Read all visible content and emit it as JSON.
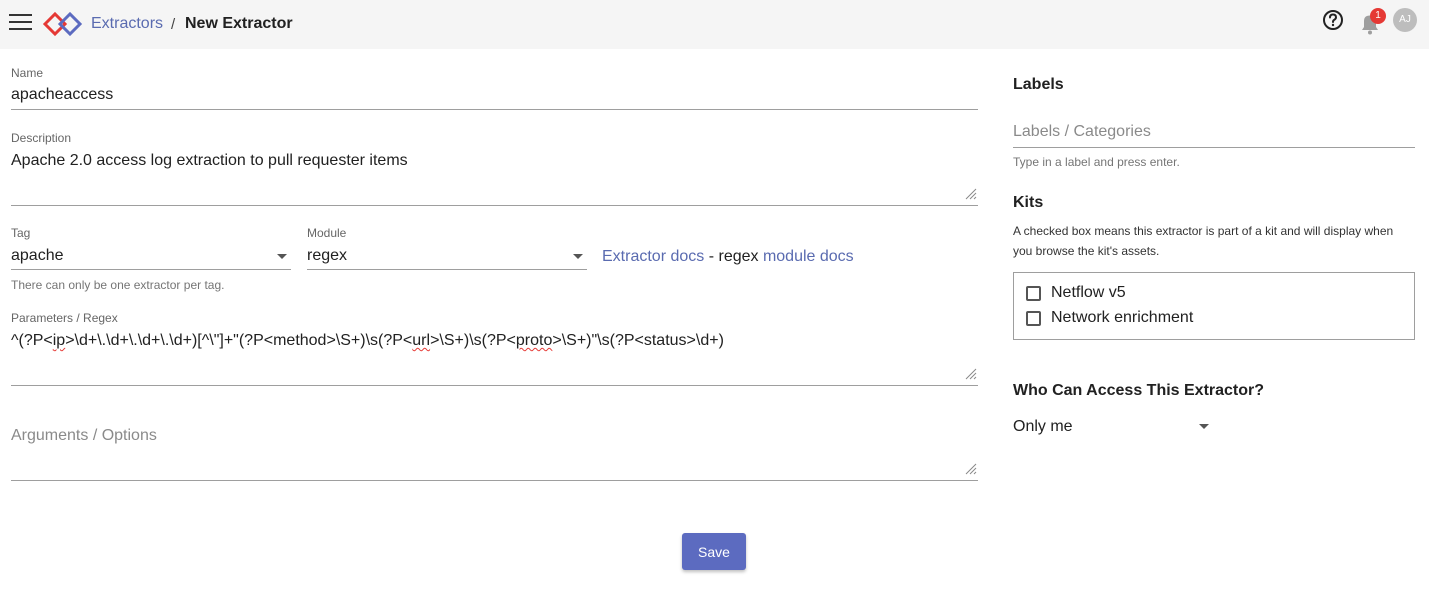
{
  "header": {
    "breadcrumb_link": "Extractors",
    "breadcrumb_sep": "/",
    "breadcrumb_current": "New Extractor",
    "notification_count": "1",
    "avatar_initials": "AJ"
  },
  "form": {
    "name": {
      "label": "Name",
      "value": "apacheaccess"
    },
    "description": {
      "label": "Description",
      "value": "Apache 2.0 access log extraction to pull requester items"
    },
    "tag": {
      "label": "Tag",
      "value": "apache",
      "helper": "There can only be one extractor per tag."
    },
    "module": {
      "label": "Module",
      "value": "regex"
    },
    "docs": {
      "extractor_docs": "Extractor docs",
      "separator": " - regex ",
      "module_docs": "module docs"
    },
    "params": {
      "label": "Parameters / Regex",
      "parts": [
        "^(?P<",
        "ip",
        ">\\d+\\.\\d+\\.\\d+\\.\\d+)[^\\\"]+\"(?P<method>\\S+)\\s(?P<",
        "url",
        ">\\S+)\\s(?P<",
        "proto",
        ">\\S+)\"\\s(?P<status>\\d+)"
      ]
    },
    "args": {
      "placeholder": "Arguments / Options"
    },
    "save_label": "Save"
  },
  "right": {
    "labels_title": "Labels",
    "labels_placeholder": "Labels / Categories",
    "labels_helper": "Type in a label and press enter.",
    "kits_title": "Kits",
    "kits_desc": "A checked box means this extractor is part of a kit and will display when you browse the kit's assets.",
    "kits": [
      {
        "label": "Netflow v5",
        "checked": false
      },
      {
        "label": "Network enrichment",
        "checked": false
      }
    ],
    "access_title": "Who Can Access This Extractor?",
    "access_value": "Only me"
  },
  "colors": {
    "accent": "#5c6bc0",
    "link": "#5a6bb0",
    "badge": "#e53935",
    "logo_blue": "#5c6bc0",
    "logo_red": "#e53935"
  }
}
